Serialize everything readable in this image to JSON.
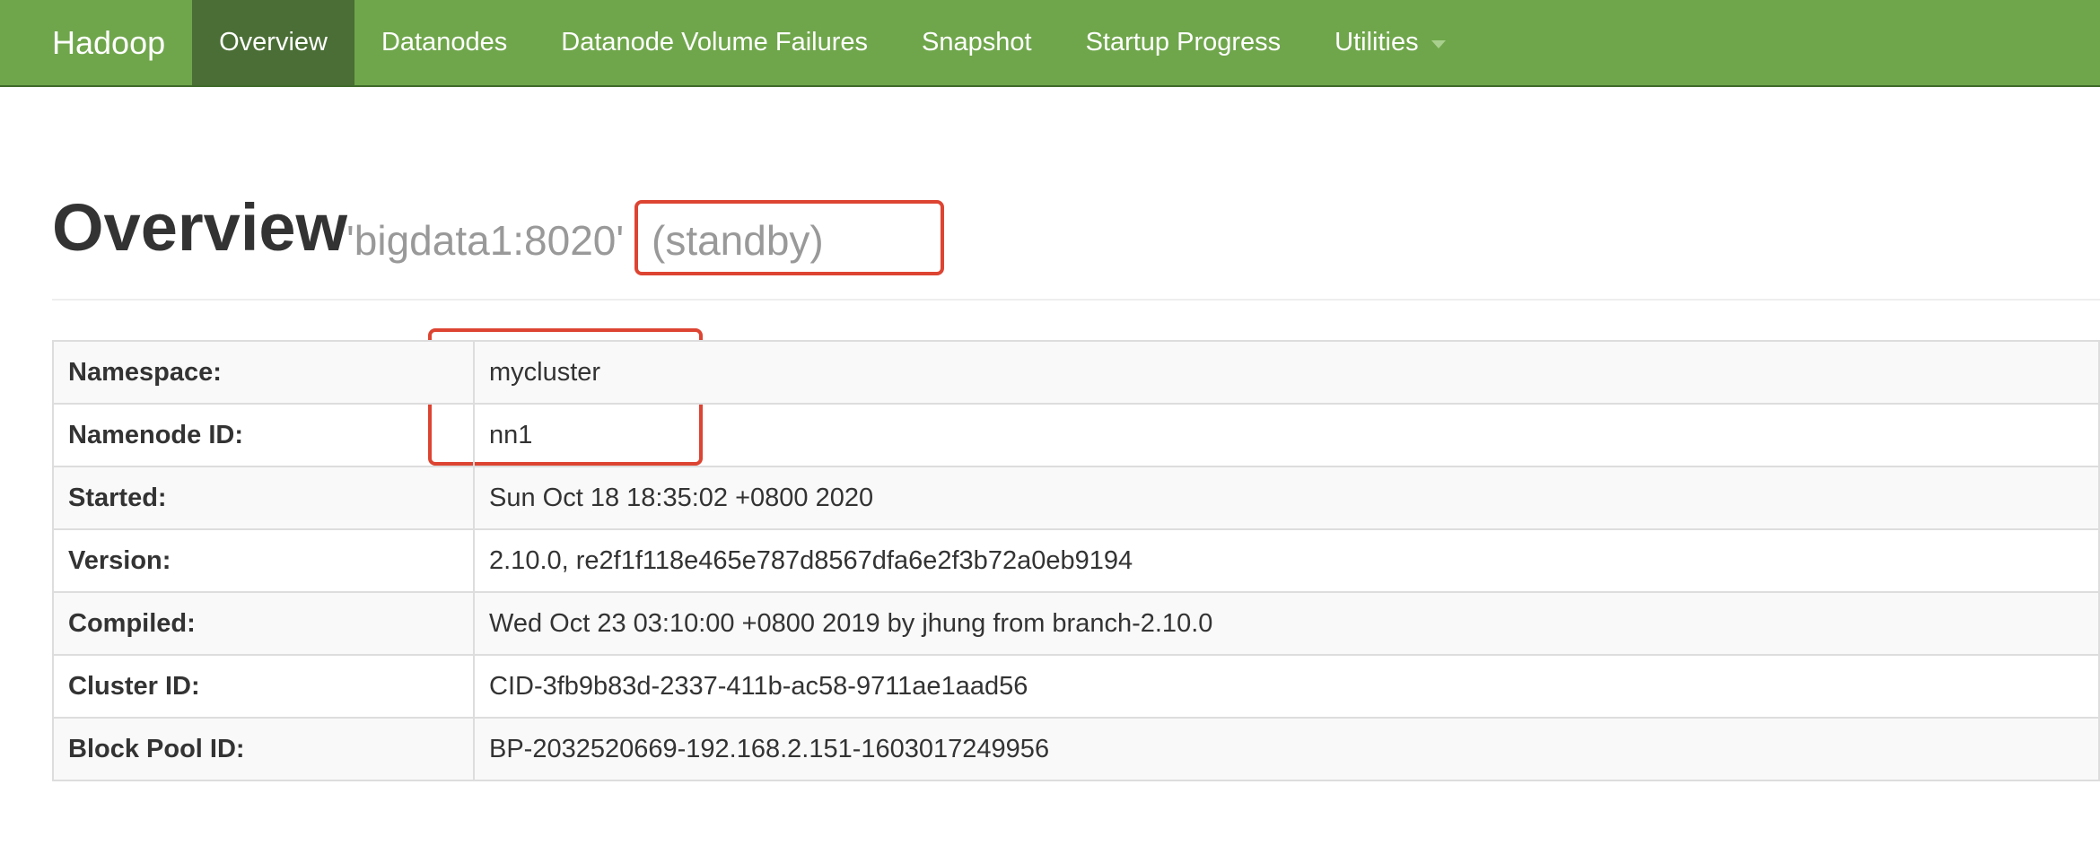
{
  "navbar": {
    "brand": "Hadoop",
    "items": [
      {
        "label": "Overview"
      },
      {
        "label": "Datanodes"
      },
      {
        "label": "Datanode Volume Failures"
      },
      {
        "label": "Snapshot"
      },
      {
        "label": "Startup Progress"
      },
      {
        "label": "Utilities"
      }
    ],
    "active_item": "Overview",
    "colors": {
      "background": "#6fa64b",
      "active": "#4a6e35"
    }
  },
  "header": {
    "title": "Overview",
    "subtitle": "'bigdata1:8020'",
    "state": "(standby)"
  },
  "overview_table": {
    "rows": [
      {
        "label": "Namespace:",
        "value": "mycluster"
      },
      {
        "label": "Namenode ID:",
        "value": "nn1"
      },
      {
        "label": "Started:",
        "value": "Sun Oct 18 18:35:02 +0800 2020"
      },
      {
        "label": "Version:",
        "value": "2.10.0, re2f1f118e465e787d8567dfa6e2f3b72a0eb9194"
      },
      {
        "label": "Compiled:",
        "value": "Wed Oct 23 03:10:00 +0800 2019 by jhung from branch-2.10.0"
      },
      {
        "label": "Cluster ID:",
        "value": "CID-3fb9b83d-2337-411b-ac58-9711ae1aad56"
      },
      {
        "label": "Block Pool ID:",
        "value": "BP-2032520669-192.168.2.151-1603017249956"
      }
    ]
  },
  "annotation_color": "#dd4432"
}
